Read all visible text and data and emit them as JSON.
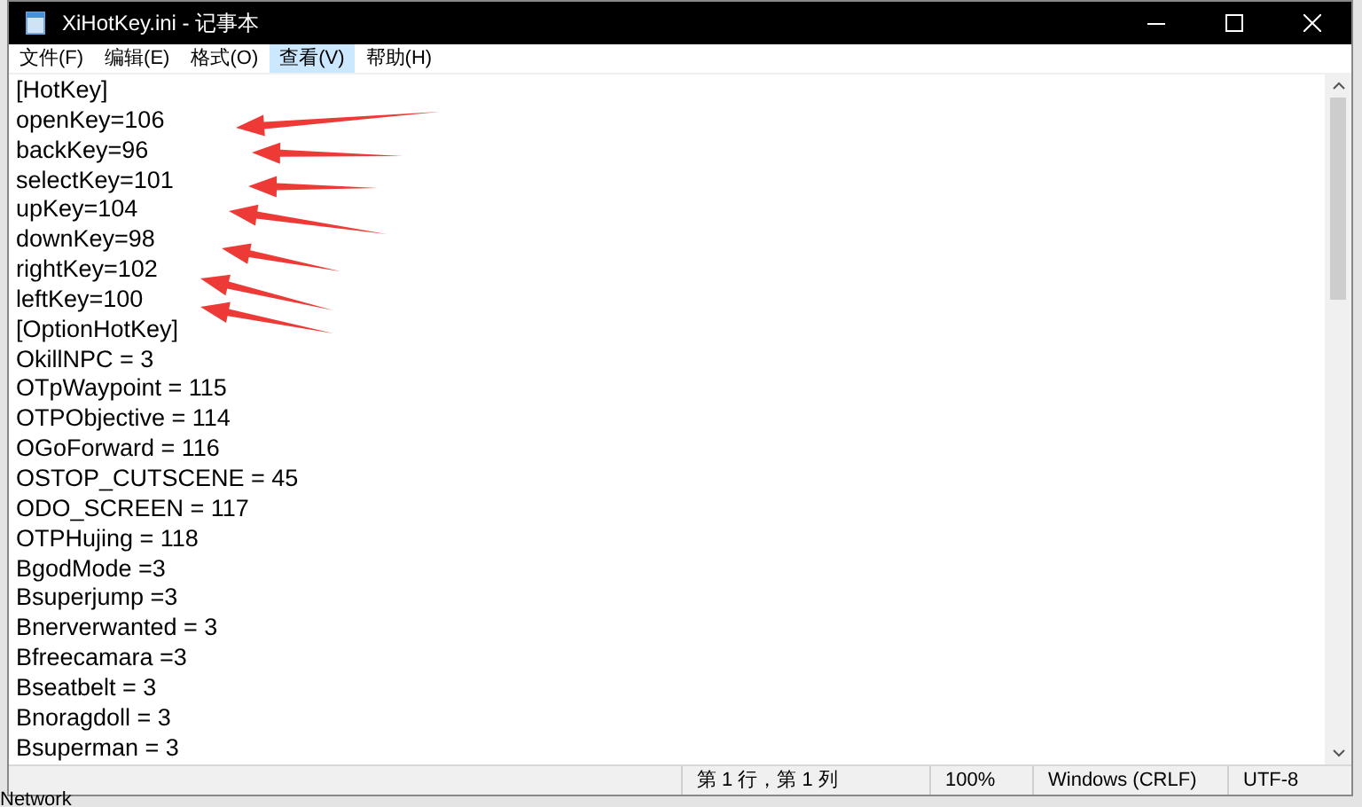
{
  "window": {
    "title": "XiHotKey.ini - 记事本"
  },
  "menu": [
    {
      "label": "文件(F)",
      "selected": false
    },
    {
      "label": "编辑(E)",
      "selected": false
    },
    {
      "label": "格式(O)",
      "selected": false
    },
    {
      "label": "查看(V)",
      "selected": true
    },
    {
      "label": "帮助(H)",
      "selected": false
    }
  ],
  "lines": [
    "[HotKey]",
    "openKey=106",
    "backKey=96",
    "selectKey=101",
    "upKey=104",
    "downKey=98",
    "rightKey=102",
    "leftKey=100",
    "[OptionHotKey]",
    "OkillNPC = 3",
    "OTpWaypoint = 115",
    "OTPObjective = 114",
    "OGoForward = 116",
    "OSTOP_CUTSCENE = 45",
    "ODO_SCREEN = 117",
    "OTPHujing = 118",
    "BgodMode =3",
    "Bsuperjump =3",
    "Bnerverwanted = 3",
    "Bfreecamara =3",
    "Bseatbelt = 3",
    "Bnoragdoll = 3",
    "Bsuperman = 3"
  ],
  "status_bar": [
    "第 1 行，第 1 列",
    "100%",
    "Windows (CRLF)",
    "UTF-8"
  ],
  "desktop": {
    "label": "Network"
  }
}
